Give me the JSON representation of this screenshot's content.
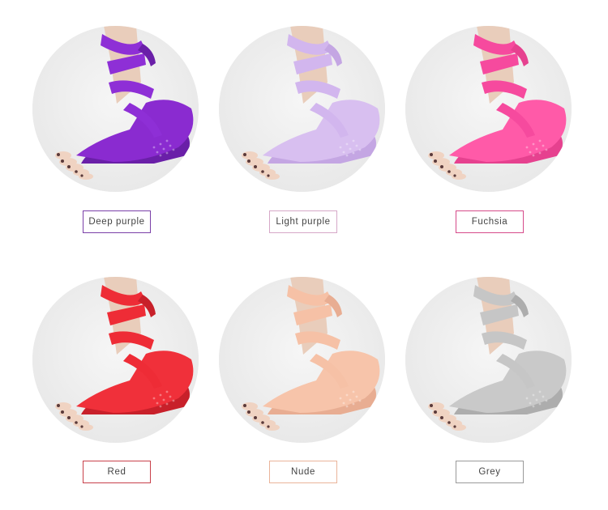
{
  "products": [
    {
      "label": "Deep purple",
      "sock_color": "#8a2bd0",
      "sock_shade": "#6a1fa8",
      "ribbon_color": "#8e2fd6",
      "border_color": "#7a3fa8"
    },
    {
      "label": "Light purple",
      "sock_color": "#d8bff0",
      "sock_shade": "#c4a6e3",
      "ribbon_color": "#d2b6ee",
      "border_color": "#d6a8c8"
    },
    {
      "label": "Fuchsia",
      "sock_color": "#ff5aa8",
      "sock_shade": "#e6418f",
      "ribbon_color": "#f64a9e",
      "border_color": "#d64a8a"
    },
    {
      "label": "Red",
      "sock_color": "#f0303a",
      "sock_shade": "#c8202a",
      "ribbon_color": "#ee2c36",
      "border_color": "#c8404a"
    },
    {
      "label": "Nude",
      "sock_color": "#f7c4aa",
      "sock_shade": "#e8ad92",
      "ribbon_color": "#f6c1a6",
      "border_color": "#eab49a"
    },
    {
      "label": "Grey",
      "sock_color": "#c9c9c9",
      "sock_shade": "#adadad",
      "ribbon_color": "#c6c6c6",
      "border_color": "#9a9a9a"
    }
  ]
}
